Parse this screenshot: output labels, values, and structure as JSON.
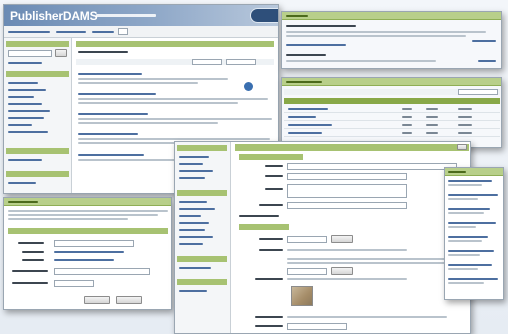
{
  "main_window": {
    "app_title": "PublisherDAMS"
  },
  "colors": {
    "header_blue": "#6b8bb4",
    "panel_green": "#a7c272",
    "panel_green_dark": "#88a848",
    "link_blue": "#4d6fa0",
    "info_icon_blue": "#3a6fb0"
  },
  "icons": [
    "info-icon",
    "thumbnail-image"
  ]
}
